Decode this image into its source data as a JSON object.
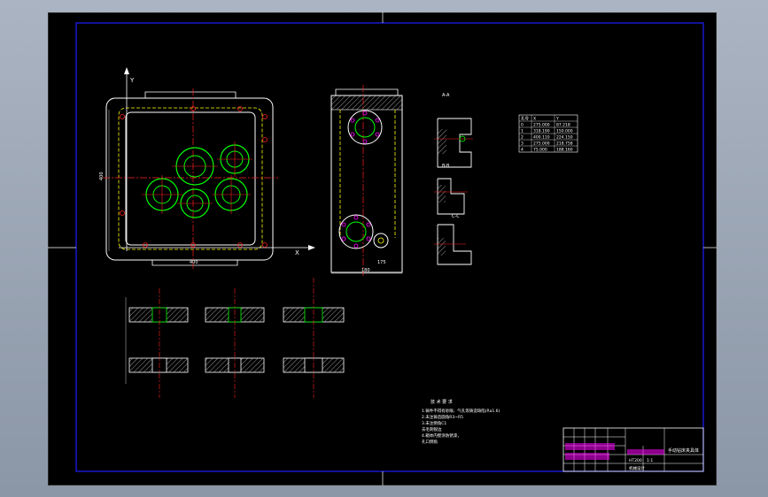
{
  "view": {
    "colors": {
      "background": "#000000",
      "frame": "#1f1fff",
      "outline": "#ffffff",
      "centerline": "#ff2020",
      "hidden": "#ffff00",
      "circles": "#00ff00",
      "magenta": "#ff00ff",
      "workspace": "#98a3b3"
    }
  },
  "drawing": {
    "main_view": {
      "axis_y": "Y",
      "axis_x": "X",
      "dim_bottom": "400",
      "dim_left": "400"
    },
    "side_view": {
      "dim_bottom": "180",
      "dim_right": "175"
    },
    "section_labels": [
      "A-A",
      "B-B",
      "C-C"
    ],
    "hole_table": {
      "headers": [
        "孔号",
        "X",
        "Y"
      ],
      "rows": [
        [
          "0",
          "275.000",
          "87.218"
        ],
        [
          "1",
          "318.190",
          "150.000"
        ],
        [
          "2",
          "400.110",
          "224.150"
        ],
        [
          "3",
          "275.000",
          "218.758"
        ],
        [
          "4",
          "75.000",
          "188.160"
        ]
      ]
    },
    "notes": {
      "title": "技 术 要 求",
      "lines": [
        "1.铸件不得有砂眼、气孔等铸造缺陷(Ra1.6)",
        "2.未注铸造圆角R3~R5",
        "3.未注倒角C1",
        "  去毛刺锐边",
        "4.箱体内壁涂防锈漆，",
        "  孔口倒角"
      ]
    },
    "title_block": {
      "name": "手动钻床夹具体",
      "material": "HT200",
      "ratio": "1:1",
      "school": "机械设计"
    }
  }
}
